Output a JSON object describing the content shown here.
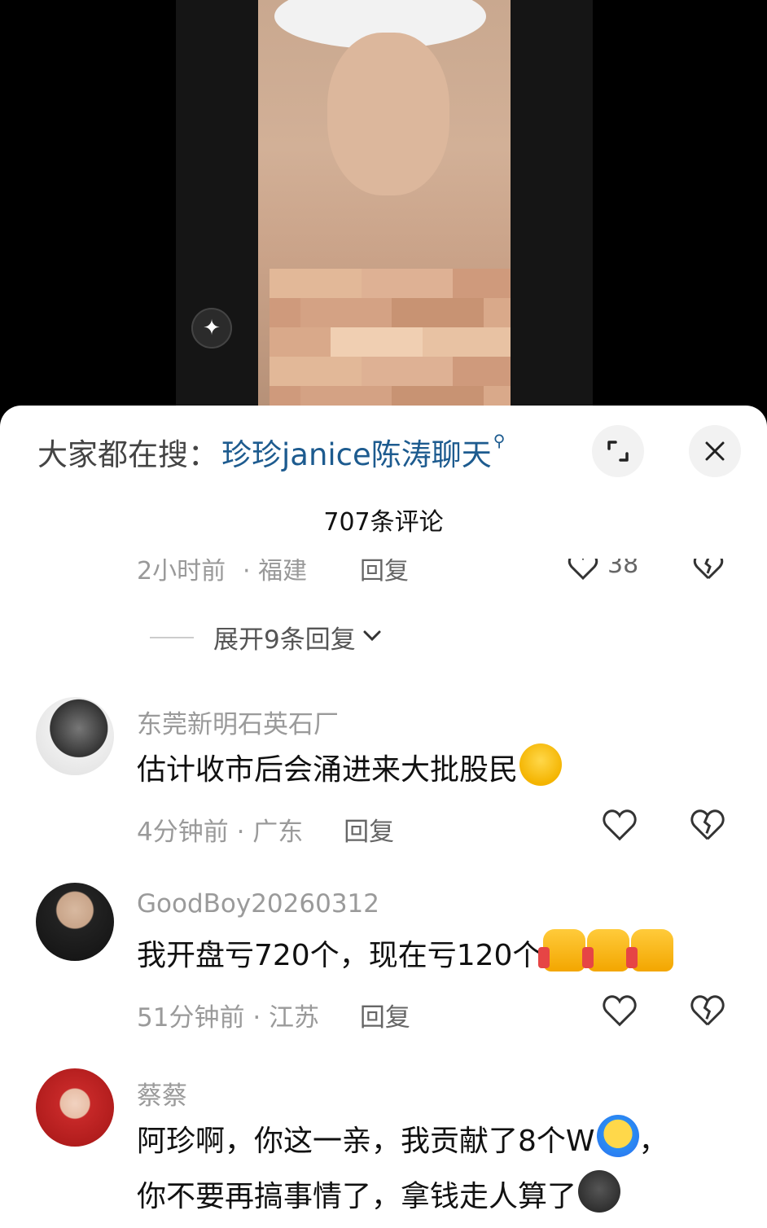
{
  "video": {
    "mosaic_label": ""
  },
  "search": {
    "prefix": "大家都在搜：",
    "query": "珍珍janice陈涛聊天",
    "icon": "search-icon"
  },
  "header": {
    "comment_count": "707条评论"
  },
  "partial_comment": {
    "time": "2小时前",
    "location": "· 福建",
    "reply": "回复",
    "likes": "38"
  },
  "expand_replies": {
    "label": "展开9条回复"
  },
  "comments": [
    {
      "username": "东莞新明石英石厂",
      "text": "估计收市后会涌进来大批股民",
      "emojis": [
        "laughing-crying-emoji"
      ],
      "time": "4分钟前",
      "location": "· 广东",
      "reply": "回复"
    },
    {
      "username": "GoodBoy20260312",
      "text": "我开盘亏720个，现在亏120个",
      "emojis": [
        "thumbs-up-emoji",
        "thumbs-up-emoji",
        "thumbs-up-emoji"
      ],
      "time": "51分钟前",
      "location": "· 江苏",
      "reply": "回复"
    },
    {
      "username": "蔡蔡",
      "text_line1": "阿珍啊，你这一亲，我贡献了8个W",
      "text_line1_tail": "，",
      "text_line2": "你不要再搞事情了，拿钱走人算了",
      "emojis": [
        "sunglasses-emoji",
        "sweat-emoji"
      ]
    }
  ]
}
